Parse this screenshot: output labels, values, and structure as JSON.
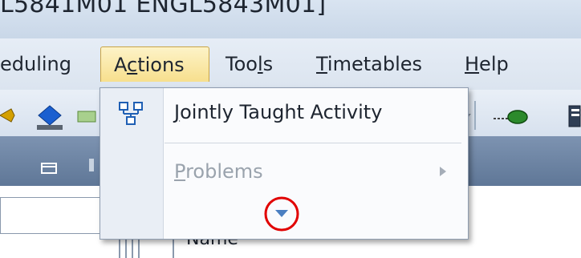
{
  "window": {
    "title": "L5841M01 ENGL5843M01]"
  },
  "menubar": {
    "items": [
      {
        "id": "scheduling",
        "label": "eduling"
      },
      {
        "id": "actions",
        "label_pre": "A",
        "label_mnemonic": "c",
        "label_post": "tions",
        "active": true
      },
      {
        "id": "tools",
        "label_pre": "Too",
        "label_mnemonic": "l",
        "label_post": "s"
      },
      {
        "id": "timetables",
        "label_pre": "",
        "label_mnemonic": "T",
        "label_post": "imetables"
      },
      {
        "id": "help",
        "label_pre": "",
        "label_mnemonic": "H",
        "label_post": "elp"
      }
    ]
  },
  "actions_menu": {
    "items": [
      {
        "label_pre": "",
        "label_mnemonic": "J",
        "label_post": "ointly Taught Activity",
        "enabled": true,
        "icon": "jointly-taught-icon"
      },
      {
        "label_pre": "",
        "label_mnemonic": "P",
        "label_post": "roblems",
        "enabled": false,
        "has_submenu": true
      }
    ],
    "expand_hint": "chevron-down-icon"
  },
  "content": {
    "column_header": "Name"
  },
  "colors": {
    "menu_highlight": "#f7df8d",
    "disabled_text": "#9aa3ad",
    "annotation_circle": "#e10000"
  }
}
